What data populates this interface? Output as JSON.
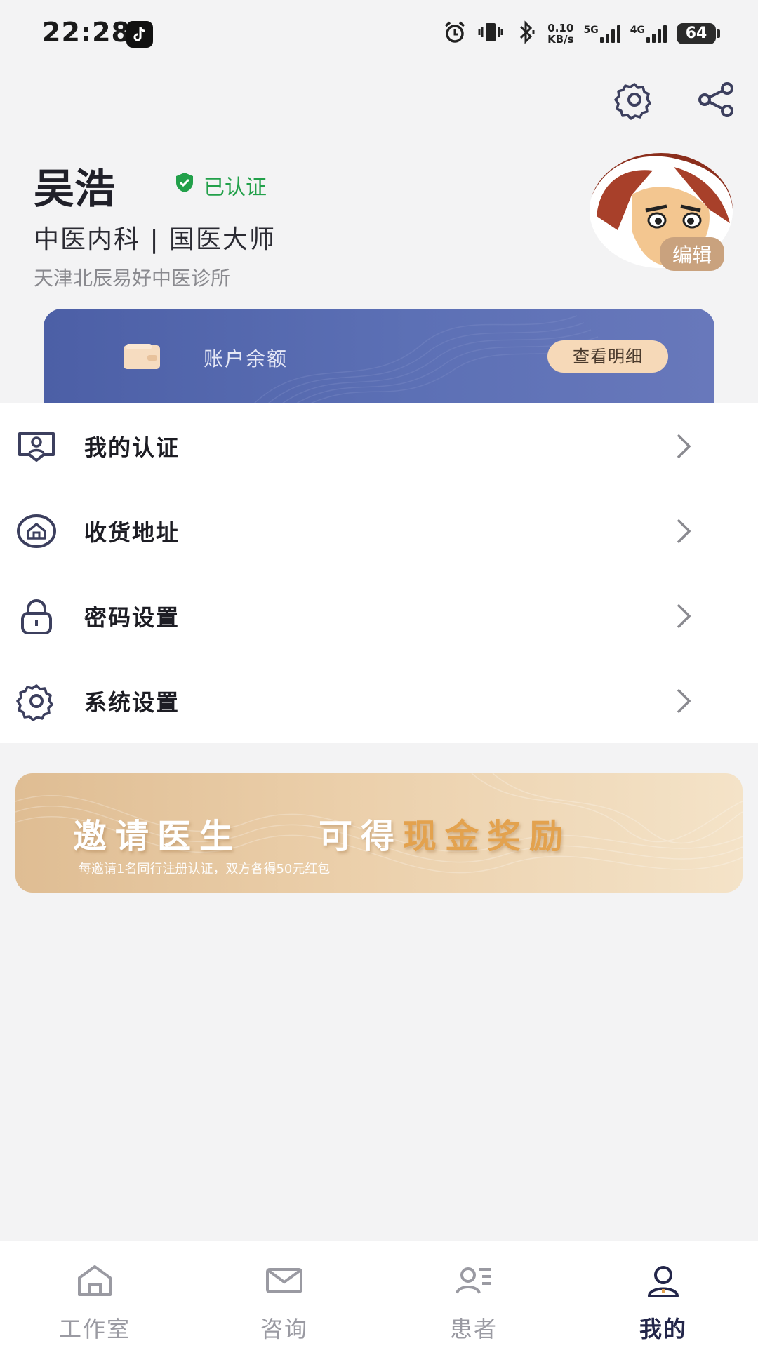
{
  "status_bar": {
    "time": "22:28",
    "net_speed_value": "0.10",
    "net_speed_unit": "KB/s",
    "signal1_label": "5G",
    "signal2_label": "4G",
    "battery": "64"
  },
  "header": {
    "settings_icon": "gear-icon",
    "share_icon": "share-icon"
  },
  "profile": {
    "name": "吴浩",
    "verified_text": "已认证",
    "department_title": "中医内科 | 国医大师",
    "clinic": "天津北辰易好中医诊所",
    "edit_label": "编辑"
  },
  "balance_card": {
    "label": "账户余额",
    "detail_button": "查看明细"
  },
  "menu": {
    "items": [
      {
        "label": "我的认证",
        "icon": "id-card-icon"
      },
      {
        "label": "收货地址",
        "icon": "home-location-icon"
      },
      {
        "label": "密码设置",
        "icon": "lock-icon"
      },
      {
        "label": "系统设置",
        "icon": "gear-icon"
      }
    ]
  },
  "invite_banner": {
    "headline_part1": "邀请医生",
    "headline_part2": "可得",
    "headline_highlight": "现金奖励",
    "subtitle": "每邀请1名同行注册认证，双方各得50元红包"
  },
  "tabbar": {
    "tabs": [
      {
        "label": "工作室",
        "icon": "house-icon",
        "active": false
      },
      {
        "label": "咨询",
        "icon": "mail-icon",
        "active": false
      },
      {
        "label": "患者",
        "icon": "patients-icon",
        "active": false
      },
      {
        "label": "我的",
        "icon": "user-icon",
        "active": true
      }
    ]
  },
  "colors": {
    "accent": "#4c5fa6",
    "verified_green": "#22a04a",
    "gold": "#e3a24e",
    "active_tab": "#23264a"
  }
}
